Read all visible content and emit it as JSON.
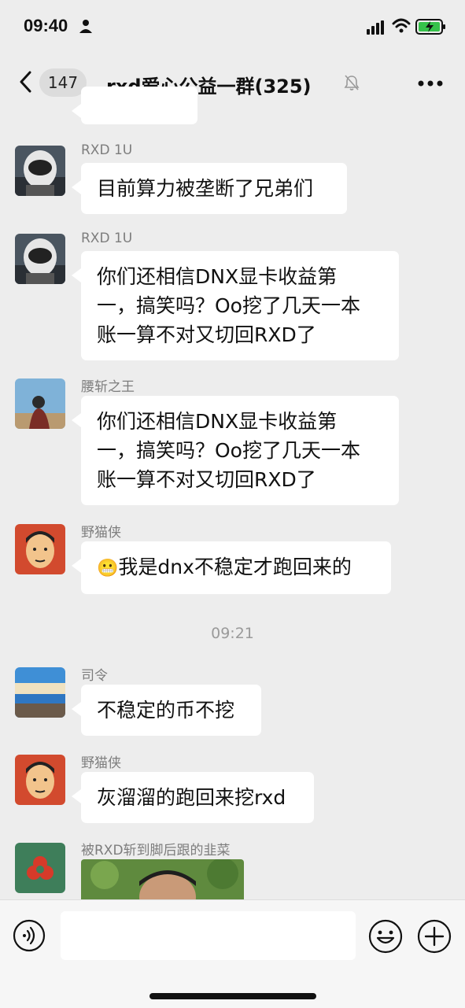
{
  "status_bar": {
    "time": "09:40"
  },
  "nav": {
    "unread_count": "147",
    "title": "rxd爱心公益一群(325)"
  },
  "messages": [
    {
      "sender": "RXD 1U",
      "lines": [
        "目前算力被垄断了兄弟们"
      ]
    },
    {
      "sender": "RXD 1U",
      "lines": [
        "你们还相信DNX显卡收益第",
        "一，搞笑吗？Oo挖了几天一本",
        "账一算不对又切回RXD了"
      ]
    },
    {
      "sender": "腰斩之王",
      "lines": [
        "你们还相信DNX显卡收益第",
        "一，搞笑吗？Oo挖了几天一本",
        "账一算不对又切回RXD了"
      ]
    },
    {
      "sender": "野猫侠",
      "lines": [
        "我是dnx不稳定才跑回来的"
      ],
      "emoji": "😬"
    },
    {
      "timestamp": "09:21"
    },
    {
      "sender": "司令",
      "lines": [
        "不稳定的币不挖"
      ]
    },
    {
      "sender": "野猫侠",
      "lines": [
        "灰溜溜的跑回来挖rxd"
      ]
    },
    {
      "sender": "被RXD斩到脚后跟的韭菜"
    }
  ],
  "input": {
    "placeholder": ""
  }
}
